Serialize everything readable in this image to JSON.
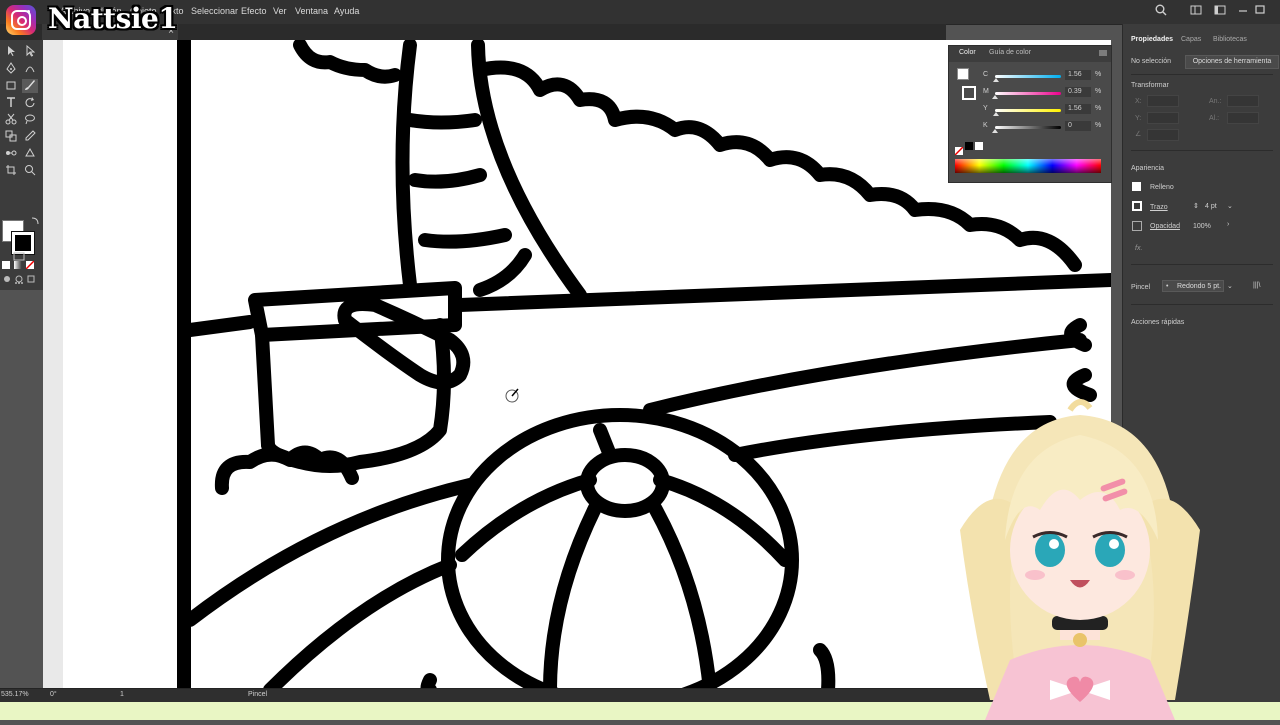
{
  "overlay": {
    "handle": "Nattsie1"
  },
  "menu": {
    "items": [
      "Archivo",
      "Edición",
      "Objeto",
      "Texto",
      "Seleccionar",
      "Efecto",
      "Ver",
      "Ventana",
      "Ayuda"
    ]
  },
  "document_tab": {
    "close": "×"
  },
  "color_panel": {
    "tabs": [
      "Color",
      "Guía de color"
    ],
    "rows": [
      {
        "label": "C",
        "value": "1.56",
        "unit": "%",
        "gradient_color": "#00aeef",
        "level": 0.0156
      },
      {
        "label": "M",
        "value": "0.39",
        "unit": "%",
        "gradient_color": "#ec008c",
        "level": 0.0039
      },
      {
        "label": "Y",
        "value": "1.56",
        "unit": "%",
        "gradient_color": "#fff200",
        "level": 0.0156
      },
      {
        "label": "K",
        "value": "0",
        "unit": "%",
        "gradient_color": "#000000",
        "level": 0
      }
    ]
  },
  "properties": {
    "tabs": [
      "Propiedades",
      "Capas",
      "Bibliotecas"
    ],
    "selection": "No selección",
    "tool_options_button": "Opciones de herramienta",
    "transform_title": "Transformar",
    "transform_fields": [
      "X:",
      "Y:",
      "An.:",
      "Al.:"
    ],
    "appearance_title": "Apariencia",
    "fill_label": "Relleno",
    "stroke_label": "Trazo",
    "stroke_value": "4 pt",
    "opacity_label": "Opacidad",
    "opacity_value": "100%",
    "fx_label": "fx.",
    "brush_label": "Pincel",
    "brush_value": "Redondo 5 pt.",
    "quick_actions_title": "Acciones rápidas"
  },
  "status": {
    "zoom": "535.17%",
    "rotation": "0°",
    "artboard": "1",
    "tool": "Pincel"
  },
  "colors": {
    "menubar": "#323232",
    "workspace": "#535353",
    "panel": "#3c3c3c",
    "artboard": "#ffffff",
    "accent_bar": "#e9f6c4"
  }
}
